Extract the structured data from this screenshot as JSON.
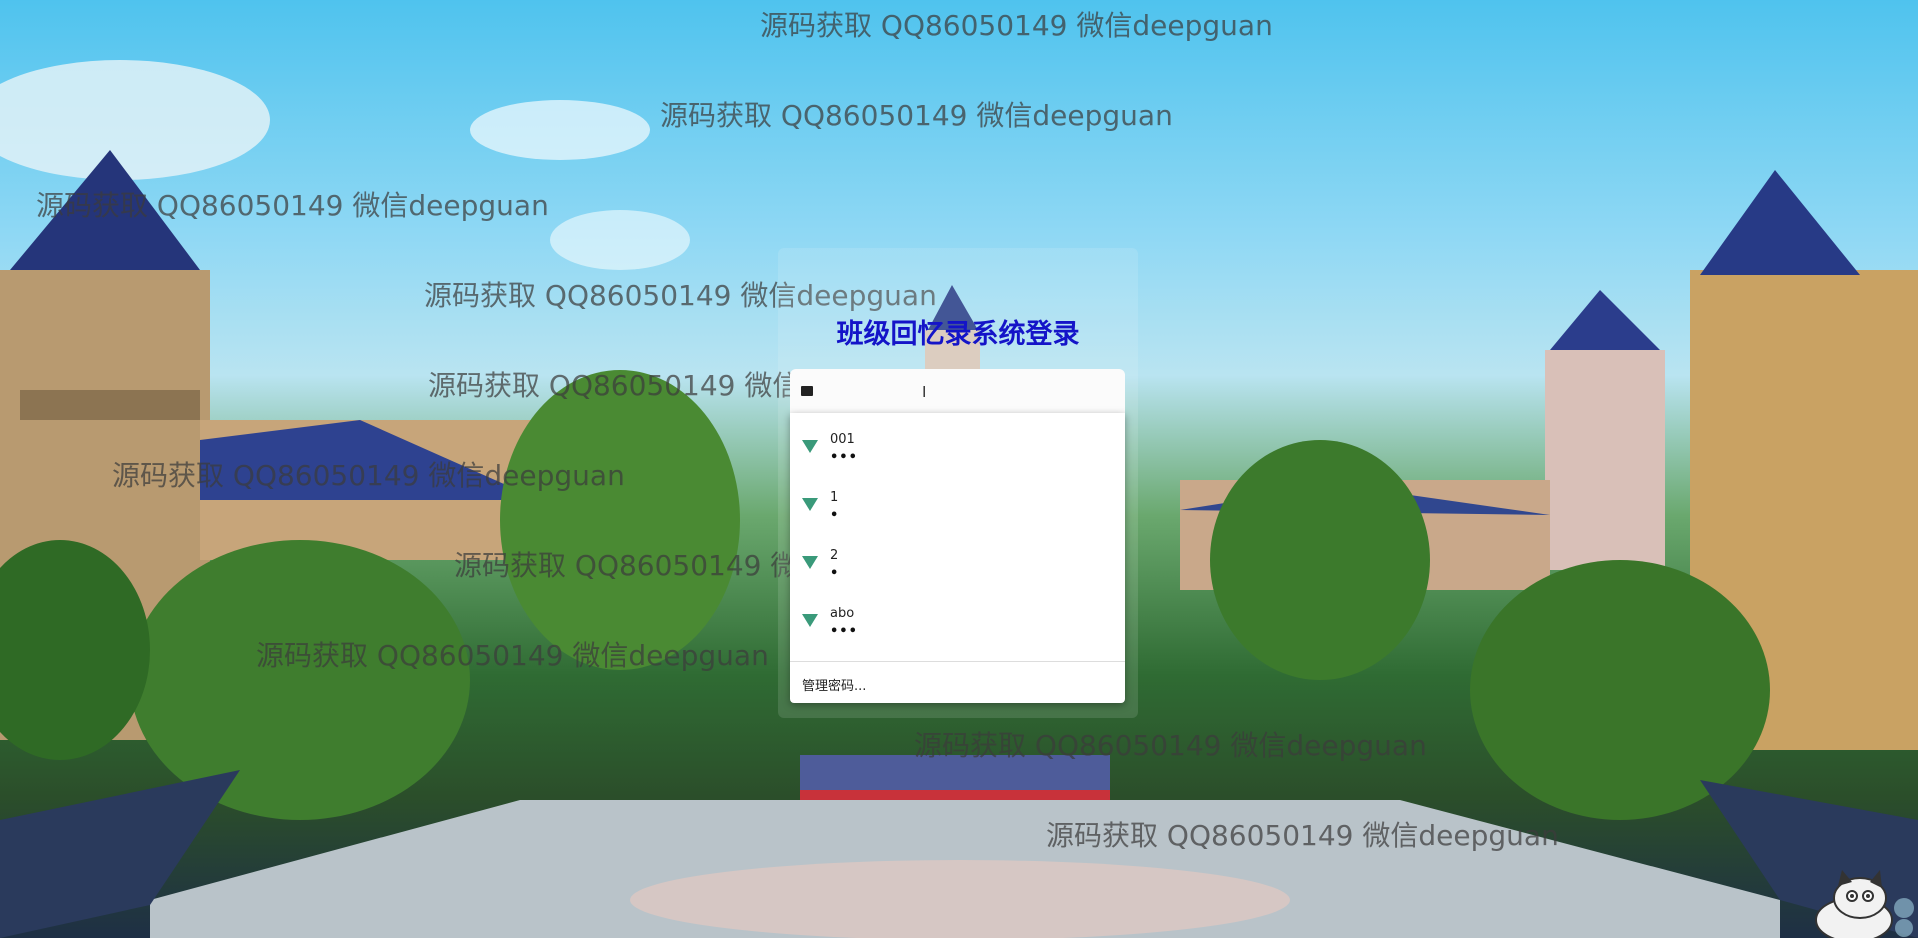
{
  "login": {
    "title": "班级回忆录系统登录",
    "account_value": ""
  },
  "dropdown": {
    "entries": [
      {
        "username": "001",
        "password": "•••"
      },
      {
        "username": "1",
        "password": "•"
      },
      {
        "username": "2",
        "password": "•"
      },
      {
        "username": "abo",
        "password": "•••"
      }
    ],
    "manage_label": "管理密码..."
  },
  "watermark": {
    "text": "源码获取 QQ86050149 微信deepguan"
  },
  "colors": {
    "title": "#1414c8",
    "key_icon": "#3a9a7a"
  },
  "icons": {
    "input": "user-icon",
    "entry": "key-icon",
    "cursor": "text-cursor-icon",
    "mascot": "mascot-icon"
  }
}
